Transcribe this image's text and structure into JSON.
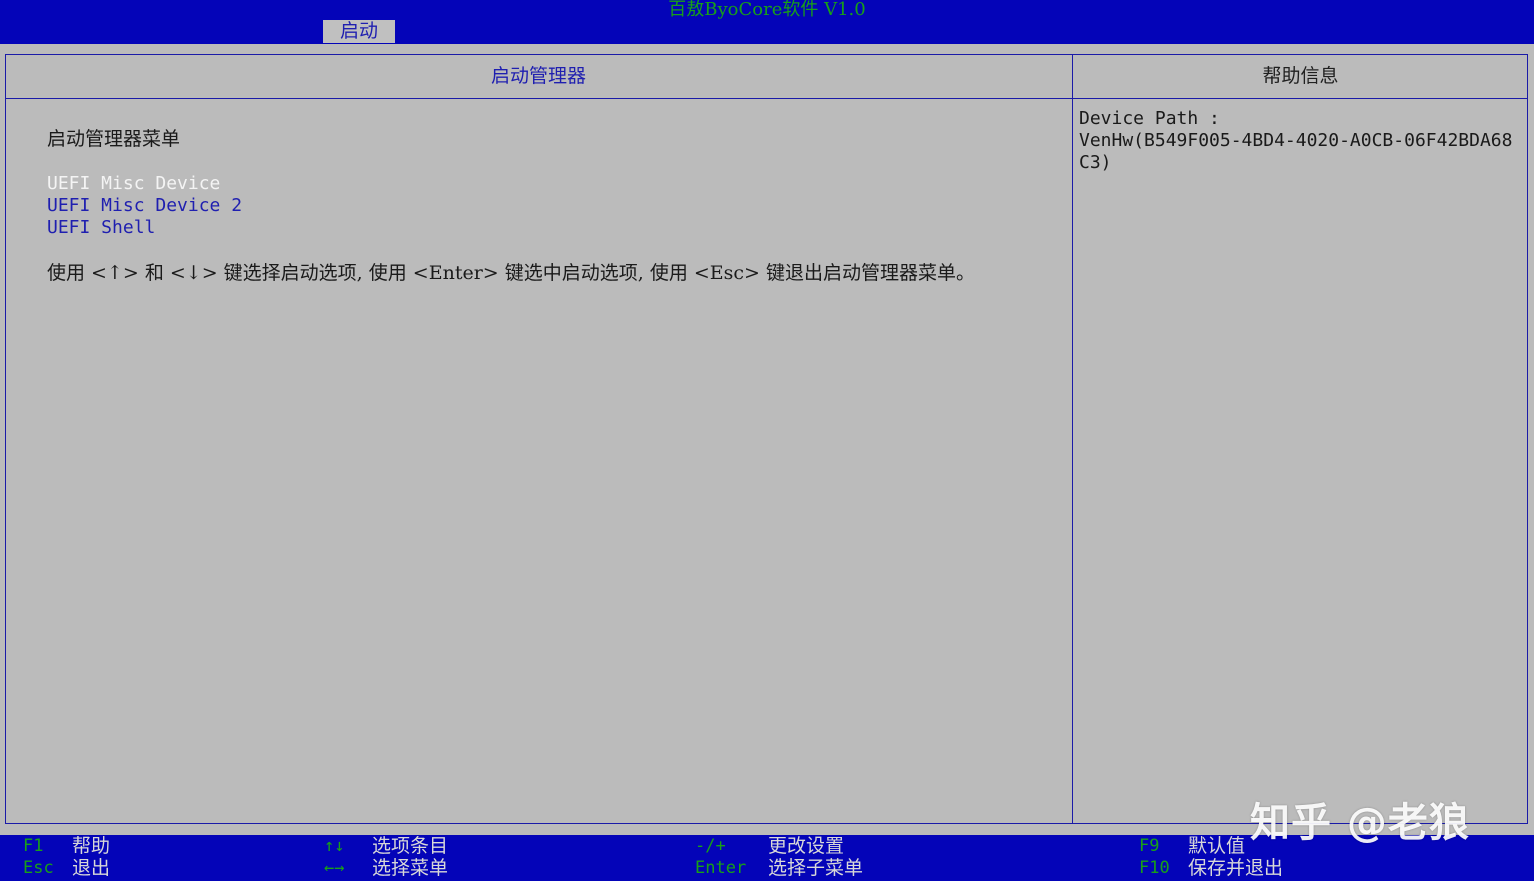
{
  "header": {
    "title": "百敖ByoCore软件 V1.0",
    "active_tab": "启动"
  },
  "left_panel": {
    "title": "启动管理器",
    "menu_heading": "启动管理器菜单",
    "items": [
      {
        "label": "UEFI Misc Device",
        "selected": true
      },
      {
        "label": "UEFI Misc Device 2",
        "selected": false
      },
      {
        "label": "UEFI Shell",
        "selected": false
      }
    ],
    "instruction": "使用 <↑> 和 <↓> 键选择启动选项, 使用 <Enter> 键选中启动选项, 使用 <Esc> 键退出启动管理器菜单。"
  },
  "right_panel": {
    "title": "帮助信息",
    "help_label": "Device Path :",
    "help_value": "VenHw(B549F005-4BD4-4020-A0CB-06F42BDA68C3)"
  },
  "footer": {
    "f1_key": "F1",
    "f1_desc": "帮助",
    "esc_key": "Esc",
    "esc_desc": "退出",
    "updown_key": "↑↓",
    "updown_desc": "选项条目",
    "leftright_key": "←→",
    "leftright_desc": "选择菜单",
    "plusminus_key": "-/+",
    "plusminus_desc": "更改设置",
    "enter_key": "Enter",
    "enter_desc": "选择子菜单",
    "f9_key": "F9",
    "f9_desc": "默认值",
    "f10_key": "F10",
    "f10_desc": "保存并退出"
  },
  "watermark": "知乎 @老狼",
  "colors": {
    "background_blue": "#0404b8",
    "panel_gray": "#bbbbbb",
    "title_green": "#18a018",
    "item_blue": "#1f1fb0",
    "selected_white": "#f4f4f4"
  }
}
